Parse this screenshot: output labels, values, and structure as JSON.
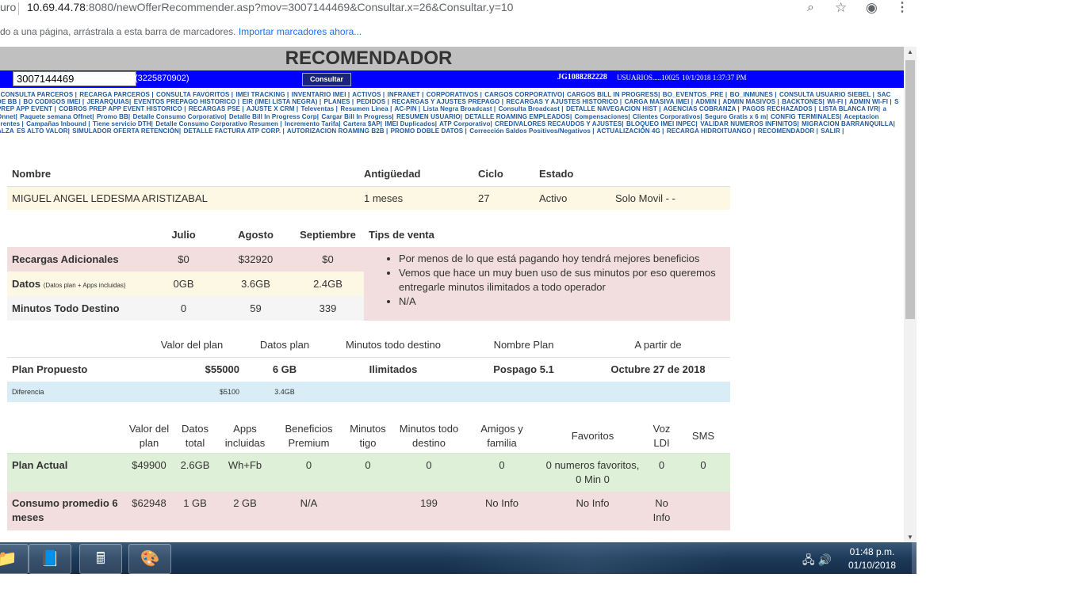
{
  "browser": {
    "prefix": "uro",
    "url_host": "10.69.44.78",
    "url_rest": ":8080/newOfferRecommender.asp?mov=3007144469&Consultar.x=26&Consultar.y=10",
    "bookmark_hint": "do a una página, arrástrala a esta barra de marcadores. ",
    "bookmark_link": "Importar marcadores ahora...",
    "icons": [
      "zoom-icon",
      "star-icon",
      "account-icon",
      "menu-icon"
    ]
  },
  "header": {
    "title": "RECOMENDADOR",
    "phone_value": "3007144469",
    "alt_phone": "(3225870902)",
    "consult_label": "Consultar",
    "user_id": "JG1088282228",
    "user_label": "USUARIOS.....10025",
    "timestamp": "10/1/2018 1:37:37 PM"
  },
  "menu": [
    "| CONSULTA PARCEROS |",
    "RECARGA PARCEROS |",
    "CONSULTA FAVORITOS |",
    "IMEI TRACKING |",
    "INVENTARIO IMEI |",
    "ACTIVOS |",
    "INFRANET |",
    "CORPORATIVOS |",
    "CARGOS CORPORATIVO|",
    "CARGOS BILL IN PROGRESS|",
    "BO_EVENTOS_PRE |",
    "BO_INMUNES |",
    "CONSULTA USUARIO SIEBEL |",
    "SAC DE BB |",
    "BO CODIGOS IMEI |",
    "JERARQUIAS|",
    "EVENTOS PREPAGO HISTORICO |",
    "EIR (IMEI LISTA NEGRA) |",
    "PLANES |",
    "PEDIDOS |",
    "RECARGAS Y AJUSTES PREPAGO |",
    "RECARGAS Y AJUSTES HISTORICO |",
    "CARGA MASIVA IMEI |",
    "ADMIN |",
    "ADMIN MASIVOS |",
    "BACKTONES|",
    "WI-FI |",
    "ADMIN WI-FI |",
    "S PREP APP EVENT |",
    "COBROS PREP APP EVENT HISTORICO |",
    "RECARGAS PSE |",
    "AJUSTE X CRM |",
    "Televentas |",
    "Resumen Linea |",
    "AC-PIN |",
    "Lista Negra Broadcast |",
    "Consulta Broadcast |",
    "DETALLE NAVEGACION HIST |",
    "AGENCIAS COBRANZA |",
    "PAGOS RECHAZADOS |",
    "LISTA BLANCA IVR|",
    "a Onnet|",
    "Paquete semana Offnet|",
    "Promo BB|",
    "Detalle Consumo Corporativo|",
    "Detalle Bill In Progress Corp|",
    "Cargar Bill In Progress|",
    "RESUMEN USUARIO|",
    "DETALLE ROAMING EMPLEADOS|",
    "Compensaciones|",
    "Clientes Corporativos|",
    "Seguro Gratis x 6 m|",
    "CONFIG TERMINALES|",
    "Aceptacion",
    "erentes |",
    "Campañas Inbound |",
    "Tiene servicio DTH|",
    "Detalle Consumo Corporativo Resumen |",
    "Incremento Tarifa|",
    "Cartera $AP|",
    "IMEI Duplicados|",
    "ATP Corporativo|",
    "CREDIVALORES RECAUDOS Y AJUSTES|",
    "BLOQUEO IMEI INPEC|",
    "VALIDAR NUMEROS INFINITOS|",
    "MIGRACION BARRANQUILLA|",
    "ALZA",
    "ES ALTO VALOR|",
    "SIMULADOR OFERTA RETENCIÓN|",
    "DETALLE FACTURA ATP CORP. |",
    "AUTORIZACION ROAMING B2B |",
    "PROMO DOBLE DATOS |",
    "Corrección Saldos Positivos/Negativos |",
    "ACTUALIZACIÓN 4G |",
    "RECARGA HIDROITUANGO |",
    "RECOMENDADOR |",
    "SALIR |"
  ],
  "client": {
    "headers": {
      "name": "Nombre",
      "age": "Antigüedad",
      "cycle": "Ciclo",
      "state": "Estado"
    },
    "name": "MIGUEL ANGEL LEDESMA ARISTIZABAL",
    "age": "1 meses",
    "cycle": "27",
    "state": "Activo",
    "type": "Solo Movil - -"
  },
  "usage": {
    "months": [
      "Julio",
      "Agosto",
      "Septiembre"
    ],
    "tips_header": "Tips de venta",
    "rows": [
      {
        "label": "Recargas Adicionales",
        "note": "",
        "values": [
          "$0",
          "$32920",
          "$0"
        ]
      },
      {
        "label": "Datos",
        "note": "(Datos plan + Apps incluidas)",
        "values": [
          "0GB",
          "3.6GB",
          "2.4GB"
        ]
      },
      {
        "label": "Minutos Todo Destino",
        "note": "",
        "values": [
          "0",
          "59",
          "339"
        ]
      }
    ],
    "tips": [
      "Por menos de lo que está pagando hoy tendrá mejores beneficios",
      "Vemos que hace un muy buen uso de sus minutos por eso queremos entregarle minutos ilimitados a todo operador",
      "N/A"
    ]
  },
  "proposed": {
    "headers": {
      "value": "Valor del plan",
      "data": "Datos plan",
      "minutes": "Minutos todo destino",
      "name": "Nombre Plan",
      "from": "A partir de"
    },
    "label": "Plan Propuesto",
    "value": "$55000",
    "data": "6 GB",
    "minutes": "Ilimitados",
    "name": "Pospago 5.1",
    "from": "Octubre 27 de 2018",
    "diff_label": "Diferencia",
    "diff_value": "$5100",
    "diff_data": "3.4GB"
  },
  "current": {
    "headers": {
      "value": "Valor del plan",
      "data": "Datos total",
      "apps": "Apps incluidas",
      "premium": "Beneficios Premium",
      "tigo": "Minutos tigo",
      "all": "Minutos todo destino",
      "friends": "Amigos y familia",
      "favorites": "Favoritos",
      "ldi": "Voz LDI",
      "sms": "SMS"
    },
    "plan": {
      "label": "Plan Actual",
      "value": "$49900",
      "data": "2.6GB",
      "apps": "Wh+Fb",
      "premium": "0",
      "tigo": "0",
      "all": "0",
      "friends": "0",
      "favorites": "0 numeros favoritos, 0 Min 0",
      "ldi": "0",
      "sms": "0"
    },
    "avg": {
      "label": "Consumo promedio 6 meses",
      "value": "$62948",
      "data": "1 GB",
      "apps": "2 GB",
      "premium": "N/A",
      "tigo": "",
      "all": "199",
      "friends": "No Info",
      "favorites": "No Info",
      "ldi": "No Info",
      "sms": ""
    }
  },
  "taskbar": {
    "apps": [
      "explorer-icon",
      "notes-icon",
      "calculator-icon",
      "paint-icon"
    ],
    "time": "01:48 p.m.",
    "date": "01/10/2018"
  }
}
